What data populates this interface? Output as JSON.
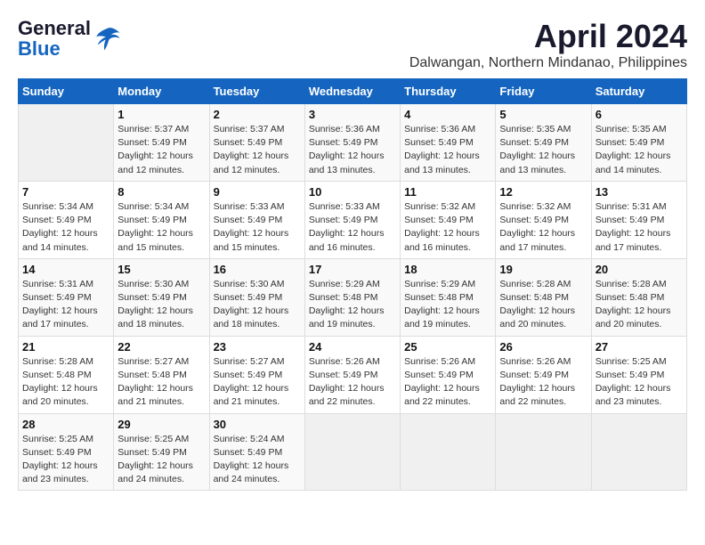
{
  "header": {
    "logo_line1": "General",
    "logo_line2": "Blue",
    "month": "April 2024",
    "location": "Dalwangan, Northern Mindanao, Philippines"
  },
  "days_of_week": [
    "Sunday",
    "Monday",
    "Tuesday",
    "Wednesday",
    "Thursday",
    "Friday",
    "Saturday"
  ],
  "weeks": [
    [
      {
        "day": "",
        "info": ""
      },
      {
        "day": "1",
        "info": "Sunrise: 5:37 AM\nSunset: 5:49 PM\nDaylight: 12 hours\nand 12 minutes."
      },
      {
        "day": "2",
        "info": "Sunrise: 5:37 AM\nSunset: 5:49 PM\nDaylight: 12 hours\nand 12 minutes."
      },
      {
        "day": "3",
        "info": "Sunrise: 5:36 AM\nSunset: 5:49 PM\nDaylight: 12 hours\nand 13 minutes."
      },
      {
        "day": "4",
        "info": "Sunrise: 5:36 AM\nSunset: 5:49 PM\nDaylight: 12 hours\nand 13 minutes."
      },
      {
        "day": "5",
        "info": "Sunrise: 5:35 AM\nSunset: 5:49 PM\nDaylight: 12 hours\nand 13 minutes."
      },
      {
        "day": "6",
        "info": "Sunrise: 5:35 AM\nSunset: 5:49 PM\nDaylight: 12 hours\nand 14 minutes."
      }
    ],
    [
      {
        "day": "7",
        "info": "Sunrise: 5:34 AM\nSunset: 5:49 PM\nDaylight: 12 hours\nand 14 minutes."
      },
      {
        "day": "8",
        "info": "Sunrise: 5:34 AM\nSunset: 5:49 PM\nDaylight: 12 hours\nand 15 minutes."
      },
      {
        "day": "9",
        "info": "Sunrise: 5:33 AM\nSunset: 5:49 PM\nDaylight: 12 hours\nand 15 minutes."
      },
      {
        "day": "10",
        "info": "Sunrise: 5:33 AM\nSunset: 5:49 PM\nDaylight: 12 hours\nand 16 minutes."
      },
      {
        "day": "11",
        "info": "Sunrise: 5:32 AM\nSunset: 5:49 PM\nDaylight: 12 hours\nand 16 minutes."
      },
      {
        "day": "12",
        "info": "Sunrise: 5:32 AM\nSunset: 5:49 PM\nDaylight: 12 hours\nand 17 minutes."
      },
      {
        "day": "13",
        "info": "Sunrise: 5:31 AM\nSunset: 5:49 PM\nDaylight: 12 hours\nand 17 minutes."
      }
    ],
    [
      {
        "day": "14",
        "info": "Sunrise: 5:31 AM\nSunset: 5:49 PM\nDaylight: 12 hours\nand 17 minutes."
      },
      {
        "day": "15",
        "info": "Sunrise: 5:30 AM\nSunset: 5:49 PM\nDaylight: 12 hours\nand 18 minutes."
      },
      {
        "day": "16",
        "info": "Sunrise: 5:30 AM\nSunset: 5:49 PM\nDaylight: 12 hours\nand 18 minutes."
      },
      {
        "day": "17",
        "info": "Sunrise: 5:29 AM\nSunset: 5:48 PM\nDaylight: 12 hours\nand 19 minutes."
      },
      {
        "day": "18",
        "info": "Sunrise: 5:29 AM\nSunset: 5:48 PM\nDaylight: 12 hours\nand 19 minutes."
      },
      {
        "day": "19",
        "info": "Sunrise: 5:28 AM\nSunset: 5:48 PM\nDaylight: 12 hours\nand 20 minutes."
      },
      {
        "day": "20",
        "info": "Sunrise: 5:28 AM\nSunset: 5:48 PM\nDaylight: 12 hours\nand 20 minutes."
      }
    ],
    [
      {
        "day": "21",
        "info": "Sunrise: 5:28 AM\nSunset: 5:48 PM\nDaylight: 12 hours\nand 20 minutes."
      },
      {
        "day": "22",
        "info": "Sunrise: 5:27 AM\nSunset: 5:48 PM\nDaylight: 12 hours\nand 21 minutes."
      },
      {
        "day": "23",
        "info": "Sunrise: 5:27 AM\nSunset: 5:49 PM\nDaylight: 12 hours\nand 21 minutes."
      },
      {
        "day": "24",
        "info": "Sunrise: 5:26 AM\nSunset: 5:49 PM\nDaylight: 12 hours\nand 22 minutes."
      },
      {
        "day": "25",
        "info": "Sunrise: 5:26 AM\nSunset: 5:49 PM\nDaylight: 12 hours\nand 22 minutes."
      },
      {
        "day": "26",
        "info": "Sunrise: 5:26 AM\nSunset: 5:49 PM\nDaylight: 12 hours\nand 22 minutes."
      },
      {
        "day": "27",
        "info": "Sunrise: 5:25 AM\nSunset: 5:49 PM\nDaylight: 12 hours\nand 23 minutes."
      }
    ],
    [
      {
        "day": "28",
        "info": "Sunrise: 5:25 AM\nSunset: 5:49 PM\nDaylight: 12 hours\nand 23 minutes."
      },
      {
        "day": "29",
        "info": "Sunrise: 5:25 AM\nSunset: 5:49 PM\nDaylight: 12 hours\nand 24 minutes."
      },
      {
        "day": "30",
        "info": "Sunrise: 5:24 AM\nSunset: 5:49 PM\nDaylight: 12 hours\nand 24 minutes."
      },
      {
        "day": "",
        "info": ""
      },
      {
        "day": "",
        "info": ""
      },
      {
        "day": "",
        "info": ""
      },
      {
        "day": "",
        "info": ""
      }
    ]
  ]
}
